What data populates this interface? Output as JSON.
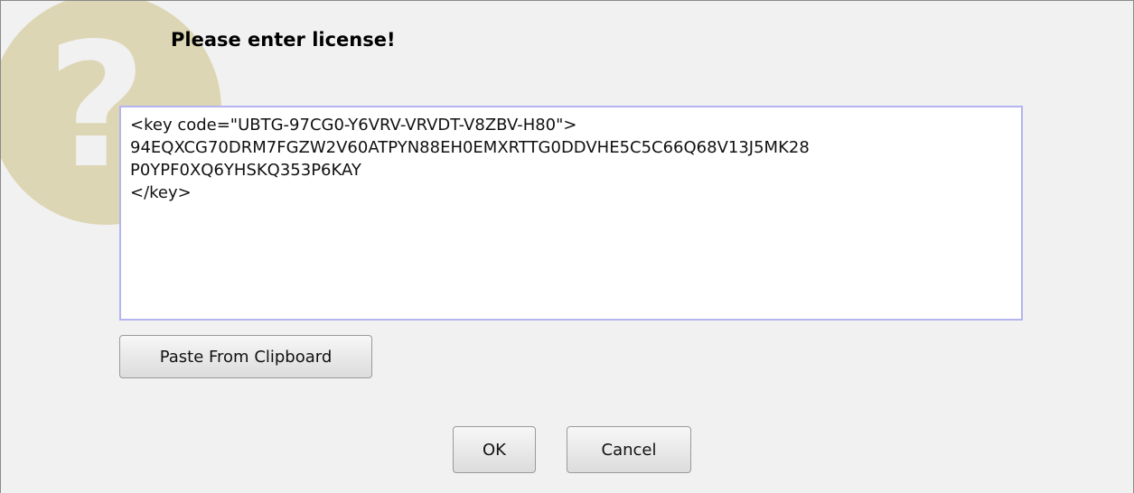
{
  "dialog": {
    "title": "Please enter license!",
    "icon": "question-mark-icon",
    "accent_color": "#ddd6b4",
    "license_text": "<key code=\"UBTG-97CG0-Y6VRV-VRVDT-V8ZBV-H80\">\n94EQXCG70DRM7FGZW2V60ATPYN88EH0EMXRTTG0DDVHE5C5C66Q68V13J5MK28\nP0YPF0XQ6YHSKQ353P6KAY\n</key>",
    "paste_label": "Paste From Clipboard",
    "ok_label": "OK",
    "cancel_label": "Cancel"
  }
}
